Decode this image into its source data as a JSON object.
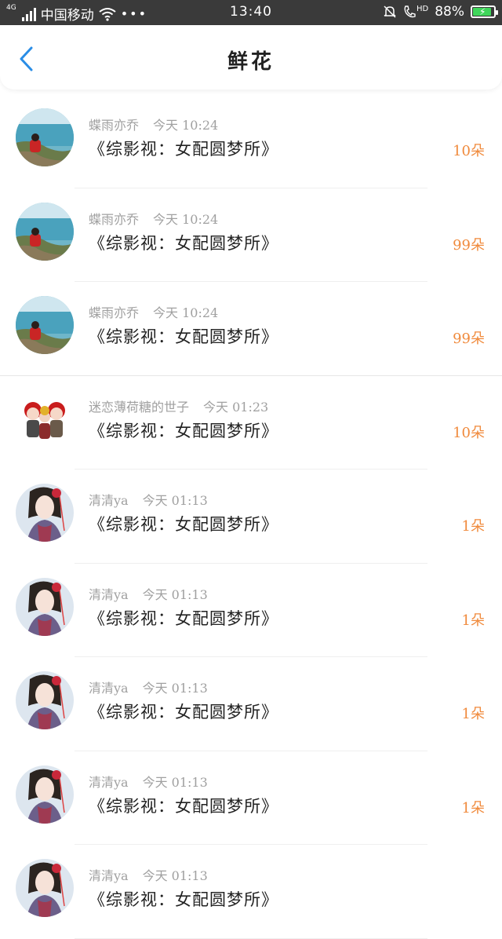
{
  "status_bar": {
    "network_tag": "4G",
    "carrier": "中国移动",
    "more": "•••",
    "time": "13:40",
    "hd": "HD",
    "battery_percent": "88%",
    "battery_level": 0.88,
    "battery_color": "#3fd65a"
  },
  "header": {
    "title": "鲜花"
  },
  "accent_color": "#f08a3c",
  "items": [
    {
      "user": "蝶雨亦乔",
      "time": "今天 10:24",
      "book": "《综影视：女配圆梦所》",
      "count": "10朵",
      "avatar": "sea-cliff-photo"
    },
    {
      "user": "蝶雨亦乔",
      "time": "今天 10:24",
      "book": "《综影视：女配圆梦所》",
      "count": "99朵",
      "avatar": "sea-cliff-photo"
    },
    {
      "user": "蝶雨亦乔",
      "time": "今天 10:24",
      "book": "《综影视：女配圆梦所》",
      "count": "99朵",
      "avatar": "sea-cliff-photo"
    },
    {
      "user": "迷恋薄荷糖的世子",
      "time": "今天 01:23",
      "book": "《综影视：女配圆梦所》",
      "count": "10朵",
      "avatar": "cartoon-girls"
    },
    {
      "user": "清清ya",
      "time": "今天 01:13",
      "book": "《综影视：女配圆梦所》",
      "count": "1朵",
      "avatar": "ancient-girl-illustration"
    },
    {
      "user": "清清ya",
      "time": "今天 01:13",
      "book": "《综影视：女配圆梦所》",
      "count": "1朵",
      "avatar": "ancient-girl-illustration"
    },
    {
      "user": "清清ya",
      "time": "今天 01:13",
      "book": "《综影视：女配圆梦所》",
      "count": "1朵",
      "avatar": "ancient-girl-illustration"
    },
    {
      "user": "清清ya",
      "time": "今天 01:13",
      "book": "《综影视：女配圆梦所》",
      "count": "1朵",
      "avatar": "ancient-girl-illustration"
    },
    {
      "user": "清清ya",
      "time": "今天 01:13",
      "book": "《综影视：女配圆梦所》",
      "count": "",
      "avatar": "ancient-girl-illustration"
    }
  ]
}
